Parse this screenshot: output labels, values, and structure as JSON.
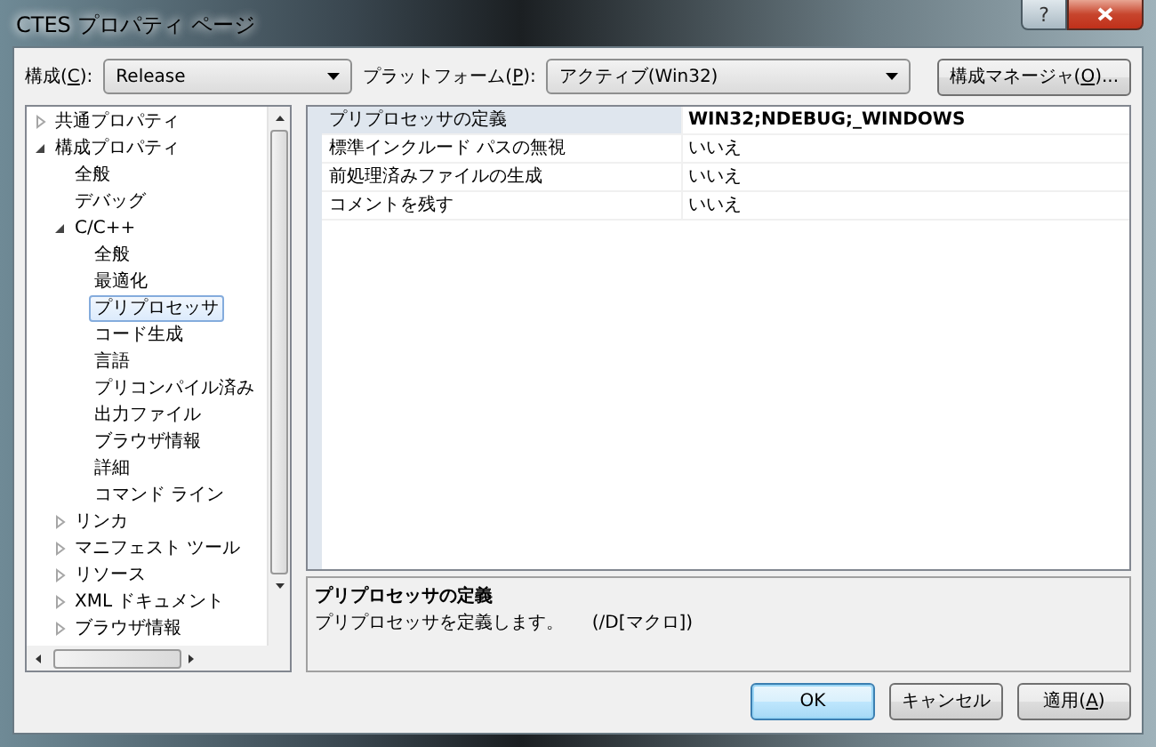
{
  "window": {
    "title": "CTES プロパティ ページ",
    "help_label": "?"
  },
  "configuration": {
    "label_before": "構成(",
    "access_key": "C",
    "label_after": "):",
    "value": "Release"
  },
  "platform": {
    "label_before": "プラットフォーム(",
    "access_key": "P",
    "label_after": "):",
    "value": "アクティブ(Win32)"
  },
  "config_manager_button": {
    "label_before": "構成マネージャ(",
    "access_key": "O",
    "label_after": ")..."
  },
  "tree": [
    {
      "label": "共通プロパティ",
      "expanded": false,
      "selected": false
    },
    {
      "label": "構成プロパティ",
      "expanded": true,
      "selected": false,
      "children": [
        {
          "label": "全般",
          "selected": false
        },
        {
          "label": "デバッグ",
          "selected": false
        },
        {
          "label": "C/C++",
          "expanded": true,
          "selected": false,
          "children": [
            {
              "label": "全般",
              "selected": false
            },
            {
              "label": "最適化",
              "selected": false
            },
            {
              "label": "プリプロセッサ",
              "selected": true
            },
            {
              "label": "コード生成",
              "selected": false
            },
            {
              "label": "言語",
              "selected": false
            },
            {
              "label": "プリコンパイル済み",
              "selected": false
            },
            {
              "label": "出力ファイル",
              "selected": false
            },
            {
              "label": "ブラウザ情報",
              "selected": false
            },
            {
              "label": "詳細",
              "selected": false
            },
            {
              "label": "コマンド ライン",
              "selected": false
            }
          ]
        },
        {
          "label": "リンカ",
          "expanded": false,
          "selected": false
        },
        {
          "label": "マニフェスト ツール",
          "expanded": false,
          "selected": false
        },
        {
          "label": "リソース",
          "expanded": false,
          "selected": false
        },
        {
          "label": "XML ドキュメント",
          "expanded": false,
          "selected": false
        },
        {
          "label": "ブラウザ情報",
          "expanded": false,
          "selected": false
        }
      ]
    }
  ],
  "properties": [
    {
      "name": "プリプロセッサの定義",
      "value": "WIN32;NDEBUG;_WINDOWS",
      "selected": true,
      "modified": true
    },
    {
      "name": "標準インクルード パスの無視",
      "value": "いいえ",
      "selected": false,
      "modified": false
    },
    {
      "name": "前処理済みファイルの生成",
      "value": "いいえ",
      "selected": false,
      "modified": false
    },
    {
      "name": "コメントを残す",
      "value": "いいえ",
      "selected": false,
      "modified": false
    }
  ],
  "description": {
    "title": "プリプロセッサの定義",
    "text": "プリプロセッサを定義します。     (/D[マクロ])"
  },
  "buttons": [
    {
      "label_before": "OK",
      "default": true
    },
    {
      "label_before": "キャンセル",
      "default": false
    },
    {
      "label_before": "適用(",
      "access_key": "A",
      "label_after": ")",
      "default": false
    }
  ]
}
